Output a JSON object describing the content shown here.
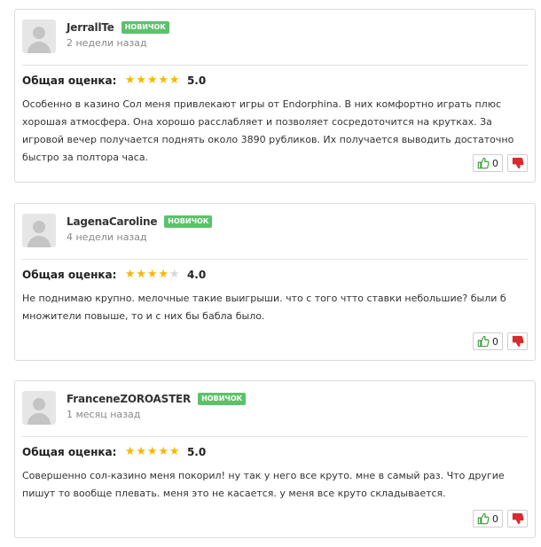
{
  "labels": {
    "rating_label": "Общая оценка:",
    "badge": "НОВИЧОК"
  },
  "colors": {
    "star_on": "#f5b800",
    "star_off": "#d6d6d6",
    "badge": "#5bc26a",
    "like": "#3a9a3a",
    "dislike": "#d92b2b"
  },
  "reviews": [
    {
      "username": "JerrallTe",
      "date": "2 недели назад",
      "rating": 5,
      "rating_value": "5.0",
      "text": "Особенно в казино Сол меня привлекают игры от Endorphina. В них комфортно играть плюс хорошая атмосфера. Она хорошо расслабляет и позволяет сосредоточится на крутках. За игровой вечер получается поднять около 3890 рубликов. Их получается выводить достаточно быстро за полтора часа.",
      "likes": "0"
    },
    {
      "username": "LagenaCaroline",
      "date": "4 недели назад",
      "rating": 4,
      "rating_value": "4.0",
      "text": "Не поднимаю крупно. мелочные такие выигрыши. что с того чтто ставки небольшие? были б множители повыше, то и с них бы бабла было.",
      "likes": "0"
    },
    {
      "username": "FranceneZOROASTER",
      "date": "1 месяц назад",
      "rating": 5,
      "rating_value": "5.0",
      "text": "Совершенно сол-казино меня покорил! ну так у него все круто. мне в самый раз. Что другие пишут то вообще плевать. меня это не касается. у меня все круто складывается.",
      "likes": "0"
    }
  ]
}
